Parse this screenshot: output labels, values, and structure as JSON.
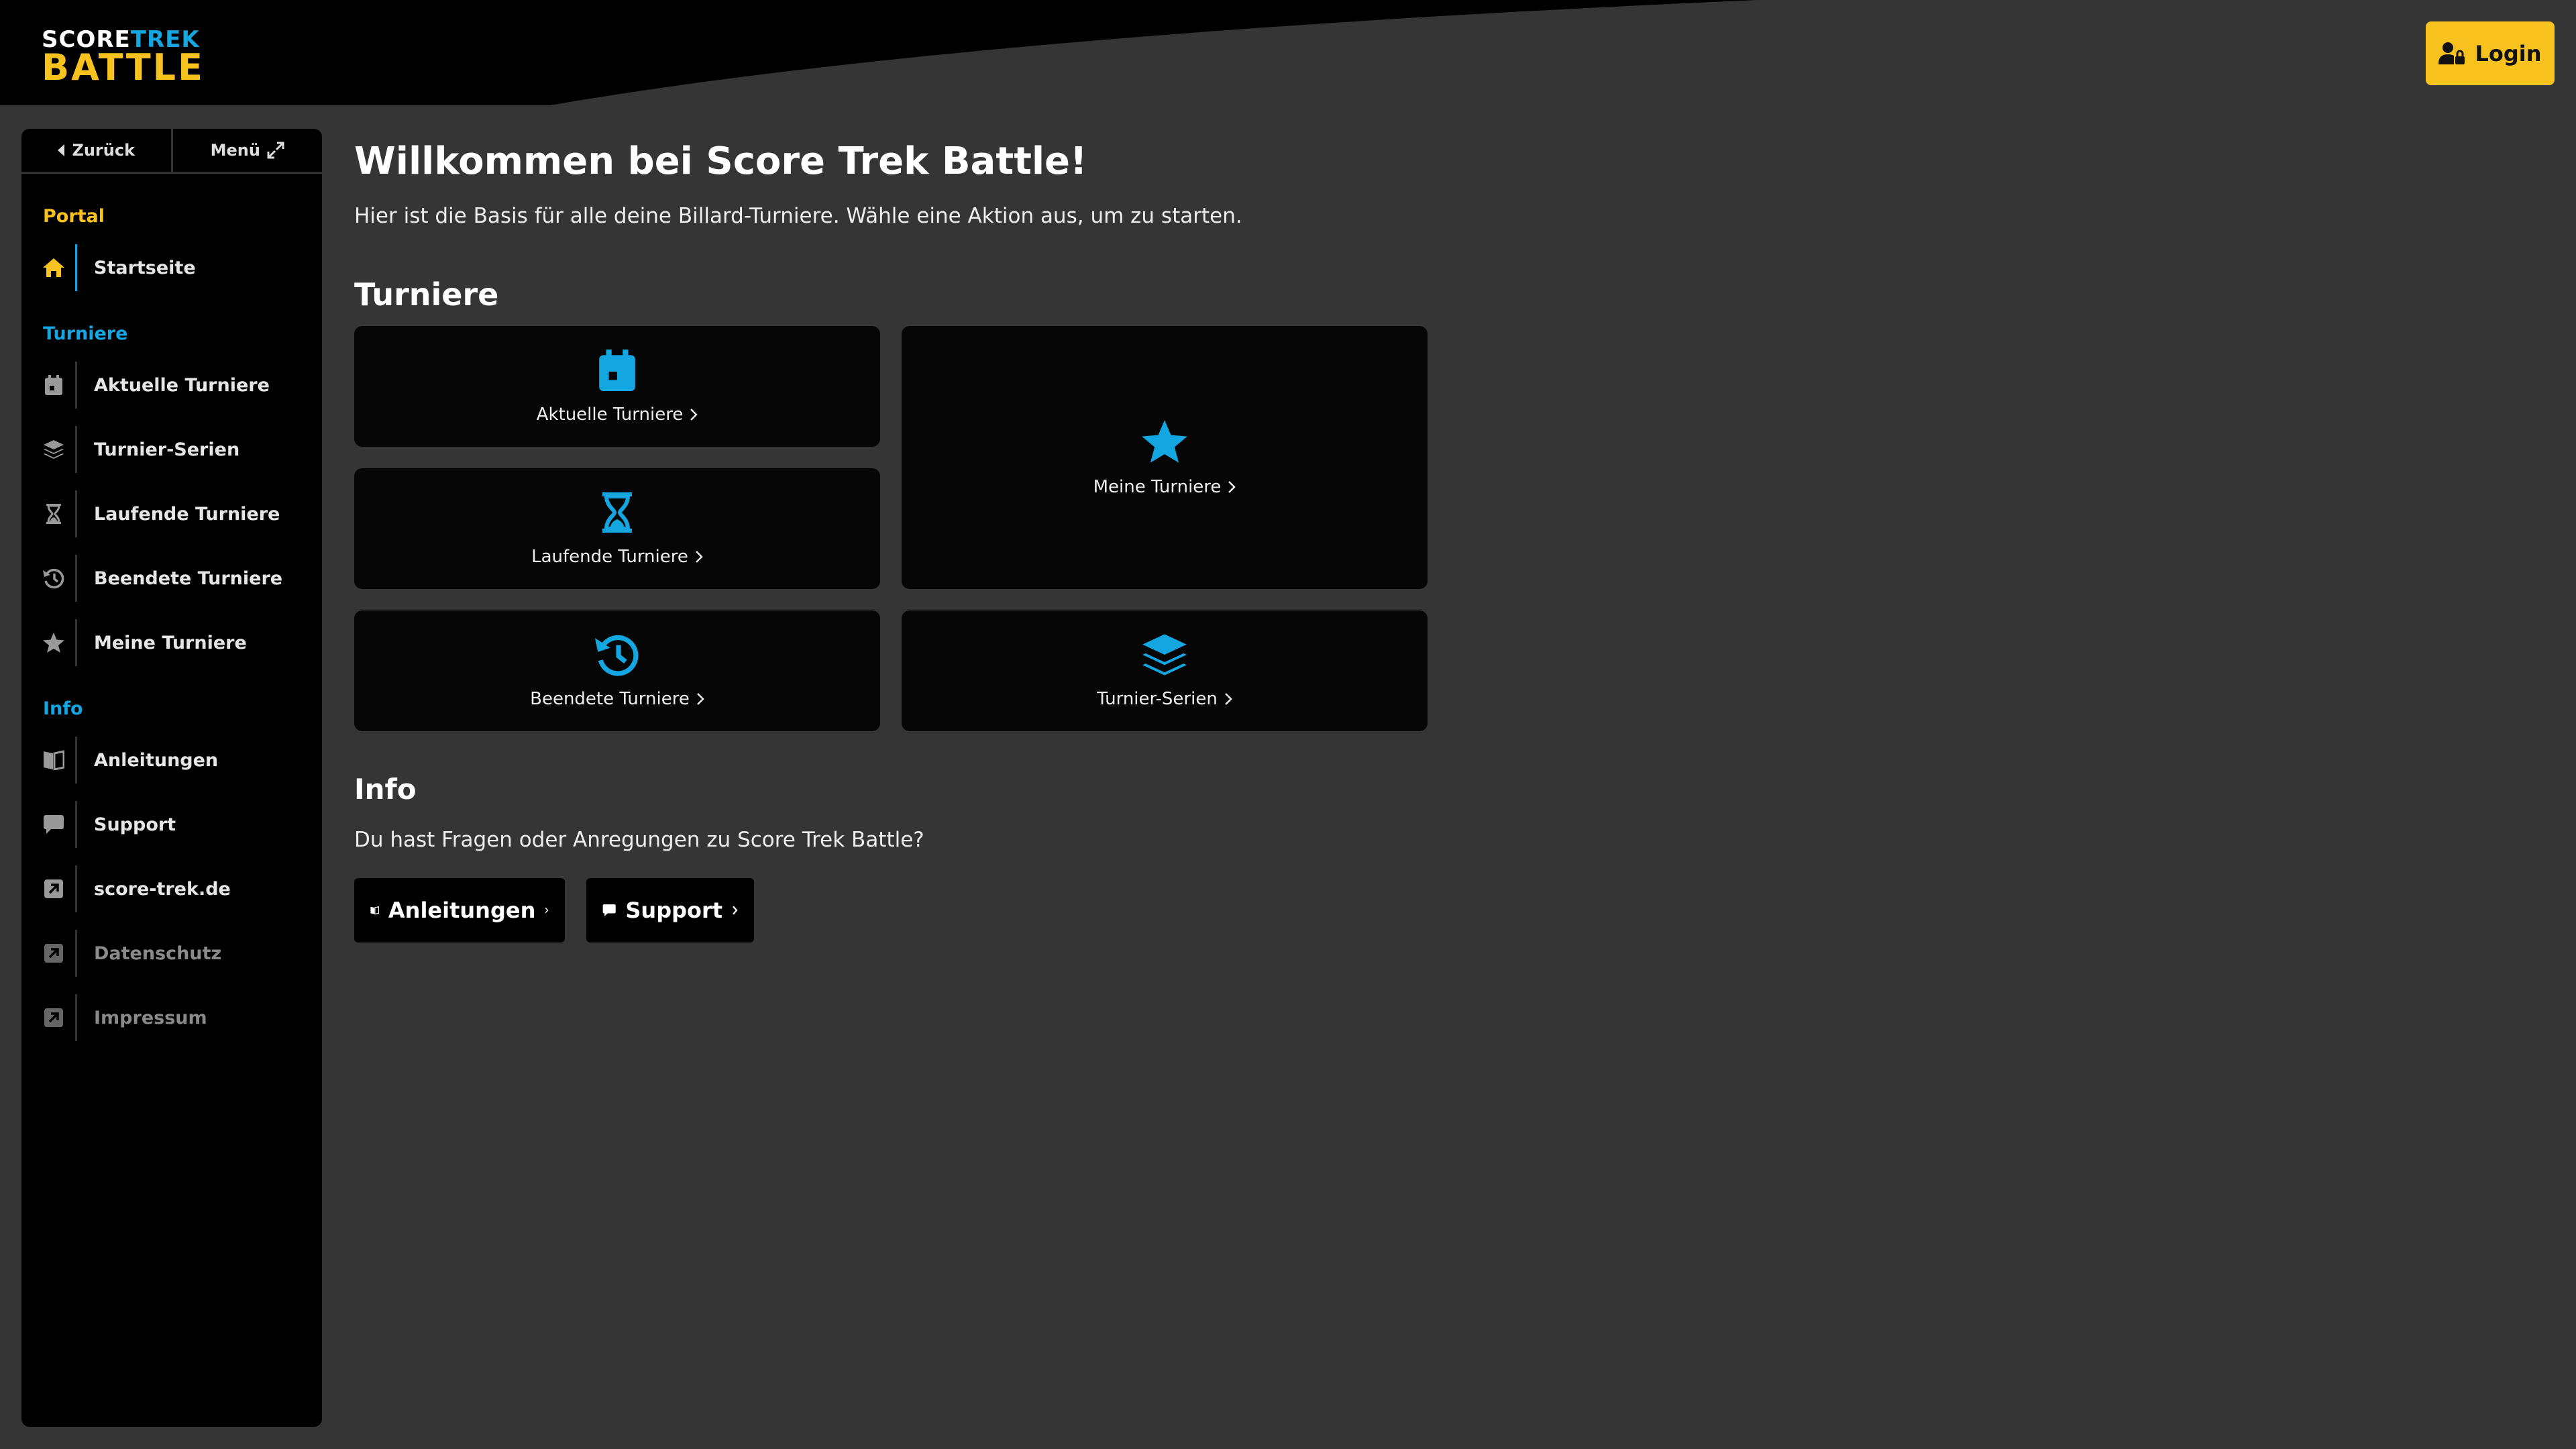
{
  "logo": {
    "line1_a": "SCORE",
    "line1_b": "TREK",
    "line2": "BATTLE"
  },
  "header": {
    "login_label": "Login"
  },
  "sidebar": {
    "back_label": "Zurück",
    "menu_label": "Menü",
    "sections": {
      "portal": "Portal",
      "turniere": "Turniere",
      "info": "Info"
    },
    "items": {
      "startseite": "Startseite",
      "aktuelle": "Aktuelle Turniere",
      "serien": "Turnier-Serien",
      "laufende": "Laufende Turniere",
      "beendete": "Beendete Turniere",
      "meine": "Meine Turniere",
      "anleitungen": "Anleitungen",
      "support": "Support",
      "scoretrek": "score-trek.de",
      "datenschutz": "Datenschutz",
      "impressum": "Impressum"
    }
  },
  "main": {
    "title": "Willkommen bei Score Trek Battle!",
    "intro": "Hier ist die Basis für alle deine Billard-Turniere. Wähle eine Aktion aus, um zu starten.",
    "turniere_heading": "Turniere",
    "tiles": {
      "aktuelle": "Aktuelle Turniere",
      "meine": "Meine Turniere",
      "laufende": "Laufende Turniere",
      "beendete": "Beendete Turniere",
      "serien": "Turnier-Serien"
    },
    "info_heading": "Info",
    "info_text": "Du hast Fragen oder Anregungen zu Score Trek Battle?",
    "anleitungen_btn": "Anleitungen",
    "support_btn": "Support"
  },
  "colors": {
    "accent_yellow": "#f7c21e",
    "accent_blue": "#14a6e0",
    "background": "#353535",
    "panel": "#000000"
  }
}
